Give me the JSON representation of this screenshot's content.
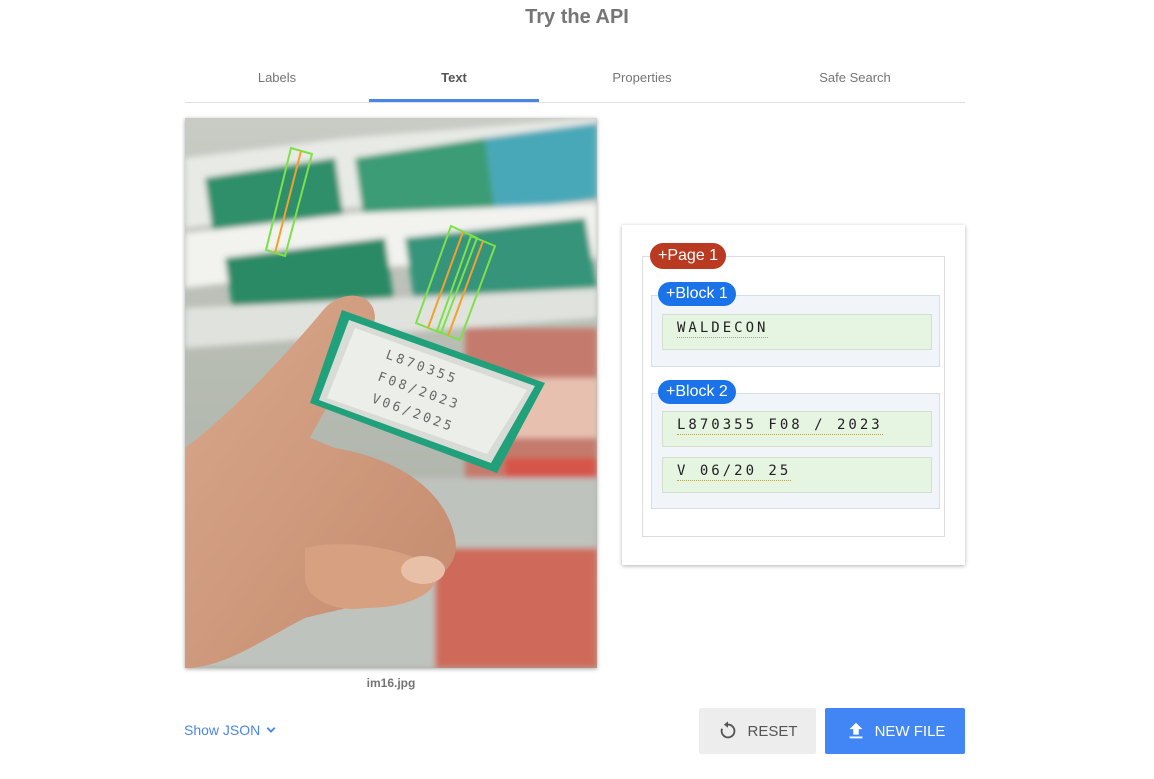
{
  "title": "Try the API",
  "tabs": [
    {
      "label": "Labels",
      "active": false
    },
    {
      "label": "Text",
      "active": true
    },
    {
      "label": "Properties",
      "active": false
    },
    {
      "label": "Safe Search",
      "active": false
    }
  ],
  "image": {
    "filename": "im16.jpg",
    "box_text": [
      "L870355",
      "F08/2023",
      "V06/2025"
    ]
  },
  "results": {
    "page_label": "+Page 1",
    "blocks": [
      {
        "label": "+Block 1",
        "lines": [
          "WALDECON"
        ]
      },
      {
        "label": "+Block 2",
        "lines": [
          "L870355 F08 / 2023",
          "V 06/20 25"
        ]
      }
    ]
  },
  "footer": {
    "show_json_label": "Show JSON",
    "reset_label": "RESET",
    "new_file_label": "NEW FILE"
  },
  "colors": {
    "accent": "#4a86e8",
    "page_badge": "#b93a20",
    "block_badge": "#1a73e8",
    "line_bg": "#e6f4e2",
    "box_green": "#7ee04a",
    "box_orange": "#f2a12a"
  },
  "icons": {
    "show_json": "chevron-down-icon",
    "reset": "reset-icon",
    "new_file": "upload-icon"
  }
}
